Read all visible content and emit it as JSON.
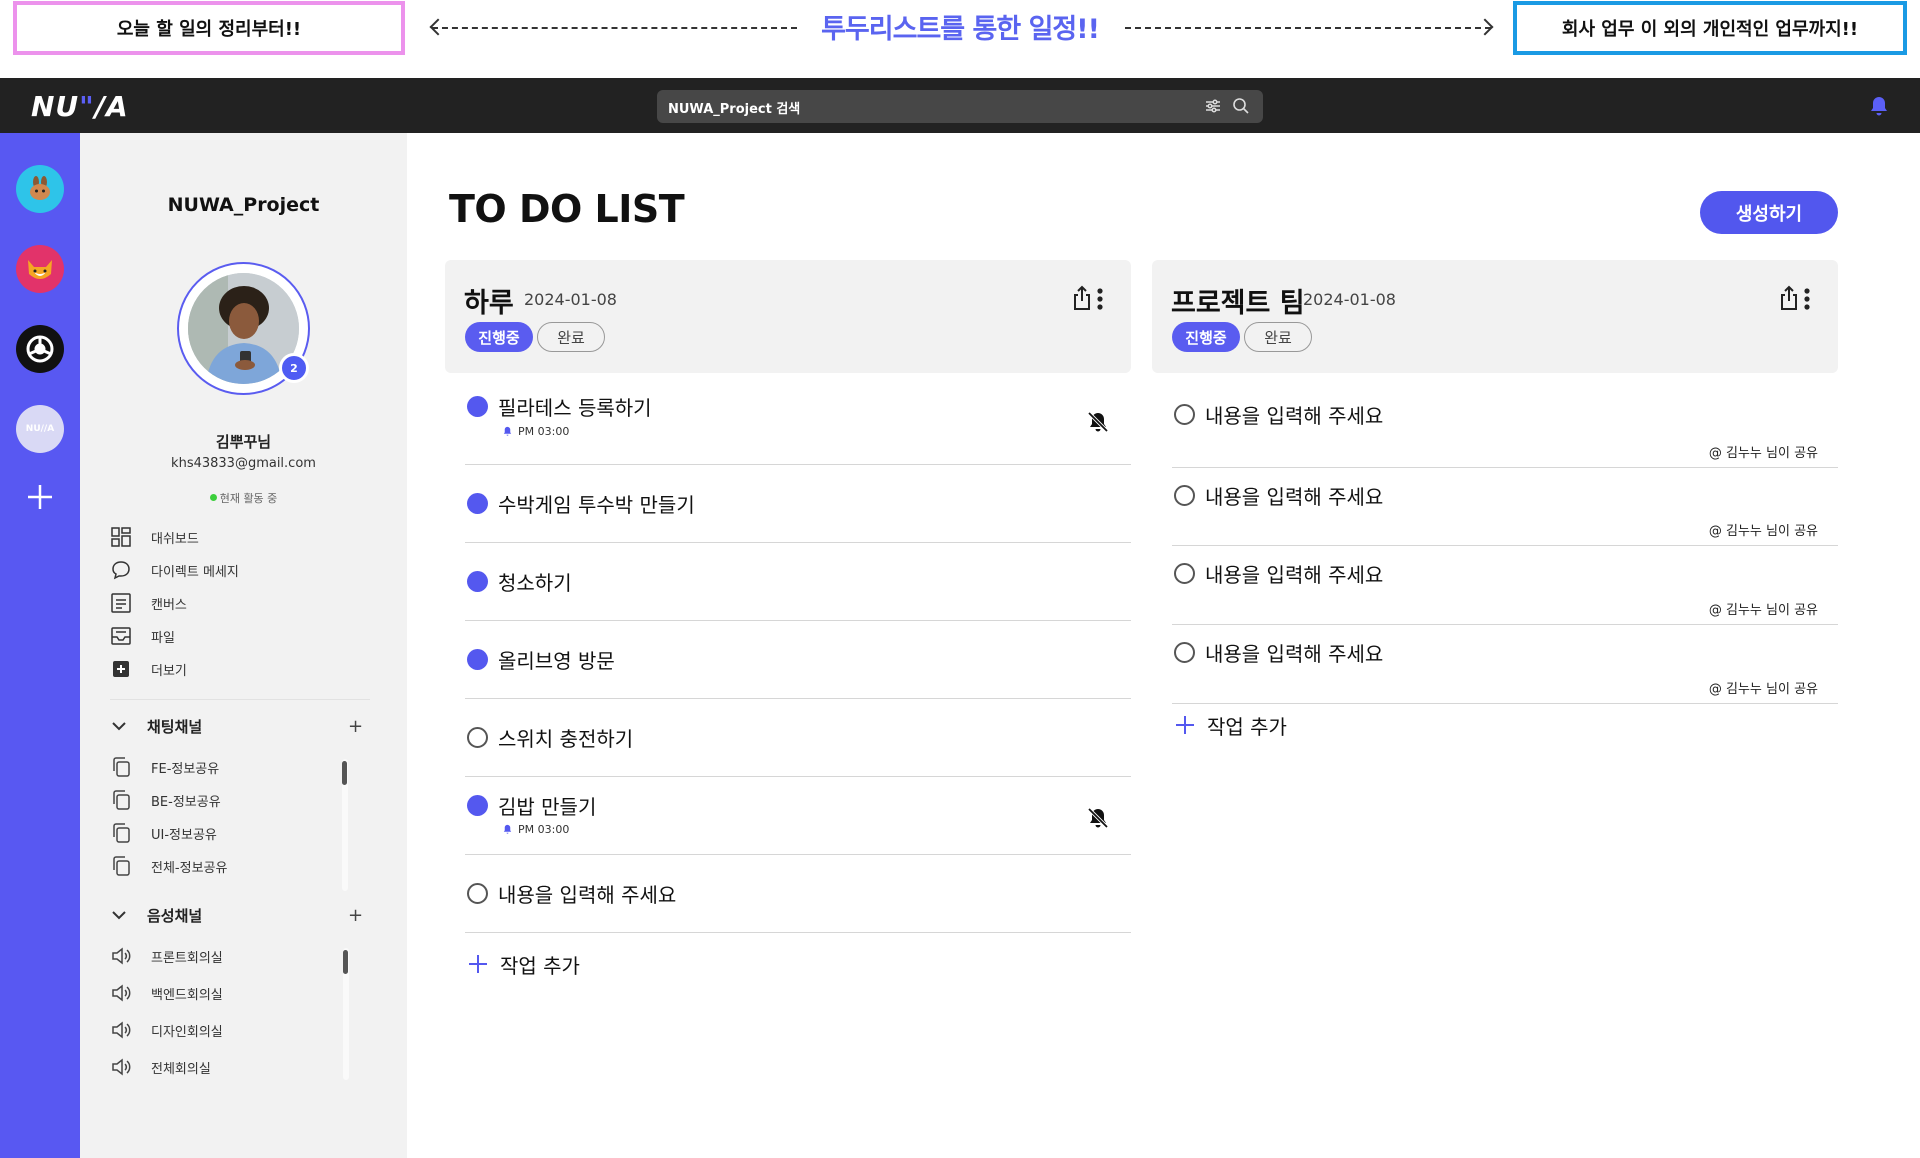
{
  "banner": {
    "left_callout": "오늘 할 일의 정리부터!!",
    "title": "투두리스트를 통한 일정!!",
    "right_callout": "회사 업무 이 외의 개인적인 업무까지!!"
  },
  "topbar": {
    "logo": "NU",
    "logo_mark": "\"",
    "logo_tail": "/A",
    "search_placeholder": "NUWA_Project 검색"
  },
  "rail": {
    "items": [
      "pancake-app-icon",
      "shiba-app-icon",
      "circle-app-icon",
      "nuwa-app-icon"
    ],
    "nuwa_label": "NU//A"
  },
  "sidebar": {
    "project_name": "NUWA_Project",
    "avatar_badge": "2",
    "user_name": "김뿌꾸님",
    "user_email": "khs43833@gmail.com",
    "user_status": "현재 활동 중",
    "nav": [
      {
        "label": "대쉬보드",
        "icon": "dashboard-icon"
      },
      {
        "label": "다이렉트 메세지",
        "icon": "chat-bubble-icon"
      },
      {
        "label": "캔버스",
        "icon": "canvas-icon"
      },
      {
        "label": "파일",
        "icon": "file-tray-icon"
      },
      {
        "label": "더보기",
        "icon": "more-plus-icon"
      }
    ],
    "chat_section": {
      "label": "채팅채널",
      "add": "+",
      "channels": [
        "FE-정보공유",
        "BE-정보공유",
        "UI-정보공유",
        "전체-정보공유"
      ]
    },
    "voice_section": {
      "label": "음성채널",
      "add": "+",
      "channels": [
        "프론트회의실",
        "백엔드회의실",
        "디자인회의실",
        "전체회의실"
      ]
    }
  },
  "main": {
    "title": "TO DO LIST",
    "create_button": "생성하기",
    "columns": [
      {
        "title": "하루",
        "date": "2024-01-08",
        "status_active": "진행중",
        "status_done": "완료",
        "tasks": [
          {
            "text": "필라테스 등록하기",
            "done": true,
            "reminder": "PM 03:00",
            "muted": true
          },
          {
            "text": "수박게임 투수박 만들기",
            "done": true
          },
          {
            "text": "청소하기",
            "done": true
          },
          {
            "text": "올리브영 방문",
            "done": true
          },
          {
            "text": "스위치 충전하기",
            "done": false
          },
          {
            "text": "김밥 만들기",
            "done": true,
            "reminder": "PM 03:00",
            "muted": true
          },
          {
            "text": "내용을 입력해 주세요",
            "done": false
          }
        ],
        "add_label": "작업 추가"
      },
      {
        "title": "프로젝트 팀",
        "date": "2024-01-08",
        "status_active": "진행중",
        "status_done": "완료",
        "tasks": [
          {
            "text": "내용을 입력해 주세요",
            "done": false,
            "shared": "@ 김누누 님이 공유"
          },
          {
            "text": "내용을 입력해 주세요",
            "done": false,
            "shared": "@ 김누누 님이 공유"
          },
          {
            "text": "내용을 입력해 주세요",
            "done": false,
            "shared": "@ 김누누 님이 공유"
          },
          {
            "text": "내용을 입력해 주세요",
            "done": false,
            "shared": "@ 김누누 님이 공유"
          }
        ],
        "add_label": "작업 추가"
      }
    ]
  },
  "colors": {
    "accent": "#5858f2",
    "topbar": "#222222",
    "sidebar": "#f2f2f2",
    "status_online": "#3ccf3c",
    "callout_left_border": "#ec92ec",
    "callout_right_border": "#1a9ae4"
  }
}
